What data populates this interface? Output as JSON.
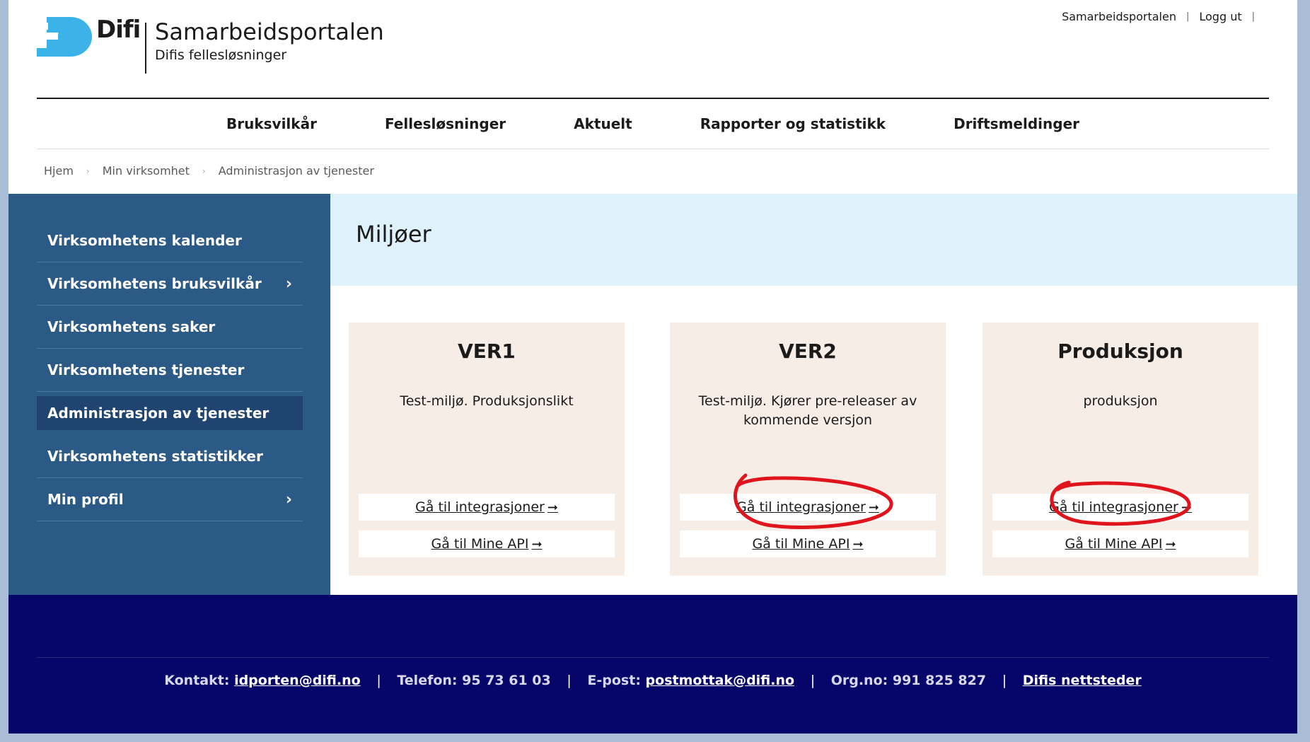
{
  "header": {
    "logo_word": "Difi",
    "site_title": "Samarbeidsportalen",
    "site_subtitle": "Difis fellesløsninger",
    "topnav": [
      "Samarbeidsportalen",
      "Logg ut"
    ],
    "brand_color": "#3bb3e8"
  },
  "mainnav": [
    "Bruksvilkår",
    "Fellesløsninger",
    "Aktuelt",
    "Rapporter og statistikk",
    "Driftsmeldinger"
  ],
  "breadcrumb": [
    "Hjem",
    "Min virksomhet",
    "Administrasjon av tjenester"
  ],
  "sidebar": {
    "items": [
      {
        "label": "Virksomhetens kalender",
        "chevron": ""
      },
      {
        "label": "Virksomhetens bruksvilkår",
        "chevron": "›"
      },
      {
        "label": "Virksomhetens saker",
        "chevron": ""
      },
      {
        "label": "Virksomhetens tjenester",
        "chevron": ""
      },
      {
        "label": "Administrasjon av tjenester",
        "chevron": ""
      },
      {
        "label": "Virksomhetens statistikker",
        "chevron": ""
      },
      {
        "label": "Min profil",
        "chevron": "›"
      }
    ]
  },
  "main": {
    "heading": "Miljøer",
    "cards": [
      {
        "title": "VER1",
        "description": "Test-miljø. Produksjonslikt",
        "link1": "Gå til integrasjoner",
        "link2": "Gå til Mine API",
        "arrow": "➞"
      },
      {
        "title": "VER2",
        "description": "Test-miljø. Kjører pre-releaser av kommende versjon",
        "link1": "Gå til integrasjoner",
        "link2": "Gå til Mine API",
        "arrow": "➞"
      },
      {
        "title": "Produksjon",
        "description": "produksjon",
        "link1": "Gå til integrasjoner",
        "link2": "Gå til Mine API",
        "arrow": "➞"
      }
    ]
  },
  "footer": {
    "contact_label": "Kontakt:",
    "contact_email": "idporten@difi.no",
    "phone": "Telefon: 95 73 61 03",
    "email_label": "E-post:",
    "email": "postmottak@difi.no",
    "orgno": "Org.no: 991 825 827",
    "sites": "Difis nettsteder",
    "separator": "|"
  }
}
